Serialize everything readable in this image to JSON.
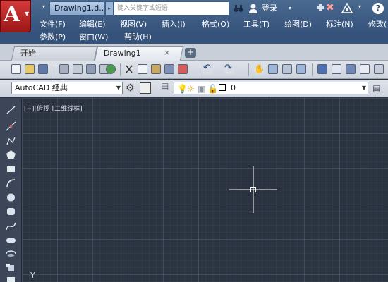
{
  "titlebar": {
    "document_name": "Drawing1.d...",
    "search_placeholder": "键入关键字或短语",
    "login_label": "登录"
  },
  "menu": {
    "row1": [
      "文件(F)",
      "编辑(E)",
      "视图(V)",
      "插入(I)",
      "格式(O)",
      "工具(T)",
      "绘图(D)",
      "标注(N)",
      "修改("
    ],
    "row2": [
      "参数(P)",
      "窗口(W)",
      "帮助(H)"
    ]
  },
  "tabs": {
    "start": "开始",
    "drawing": "Drawing1",
    "close_glyph": "×",
    "add_glyph": "+"
  },
  "propbar": {
    "workspace": "AutoCAD 经典",
    "layer": "0"
  },
  "canvas": {
    "viewport_label": "[−][俯视][二维线框]",
    "ucs_axis": "Y"
  },
  "colors": {
    "title_bg": "#3b5b84",
    "app_button": "#c62828",
    "canvas_bg": "#2b3340",
    "crosshair": "#ffffff"
  },
  "icons": {
    "app": "autocad-logo-icon",
    "search": "binoculars-icon",
    "user": "user-icon",
    "help": "help-icon",
    "settings": "gear-icon"
  }
}
